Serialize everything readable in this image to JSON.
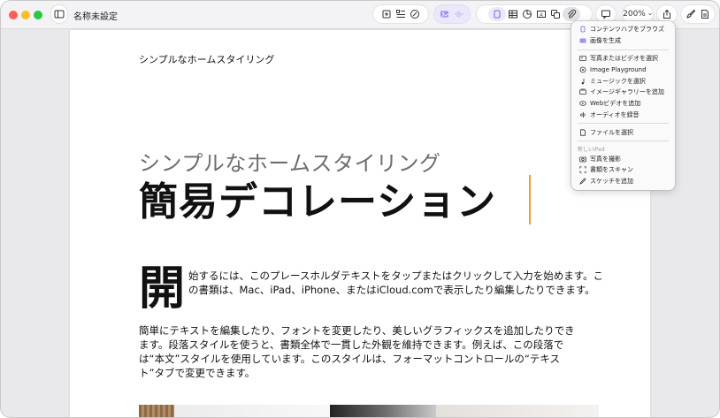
{
  "window": {
    "title": "名称未設定"
  },
  "toolbar": {
    "zoom_label": "200%"
  },
  "document": {
    "header": "シンプルなホームスタイリング",
    "subtitle": "シンプルなホームスタイリング",
    "title": "簡易デコレーション",
    "dropcap": "開",
    "paragraph1": "始するには、このプレースホルダテキストをタップまたはクリックして入力を始めます。この書類は、Mac、iPad、iPhone、またはiCloud.comで表示したり編集したりできます。",
    "paragraph2": "簡単にテキストを編集したり、フォントを変更したり、美しいグラフィックスを追加したりできます。段落スタイルを使うと、書類全体で一貫した外観を維持できます。例えば、この段落では“本文”スタイルを使用しています。このスタイルは、フォーマットコントロールの“テキスト”タブで変更できます。"
  },
  "menu": {
    "group1": [
      "コンテンツハブをブラウズ",
      "画像を生成"
    ],
    "group2": [
      "写真またはビデオを選択",
      "Image Playground",
      "ミュージックを選択",
      "イメージギャラリーを追加",
      "Webビデオを追加",
      "オーディオを録音"
    ],
    "group3": [
      "ファイルを選択"
    ],
    "section_label": "新しいiPad",
    "group4": [
      "写真を撮影",
      "書類をスキャン",
      "スケッチを追加"
    ]
  },
  "colors": {
    "accent_purple": "#7b61e8",
    "caret": "#f0a12c"
  }
}
